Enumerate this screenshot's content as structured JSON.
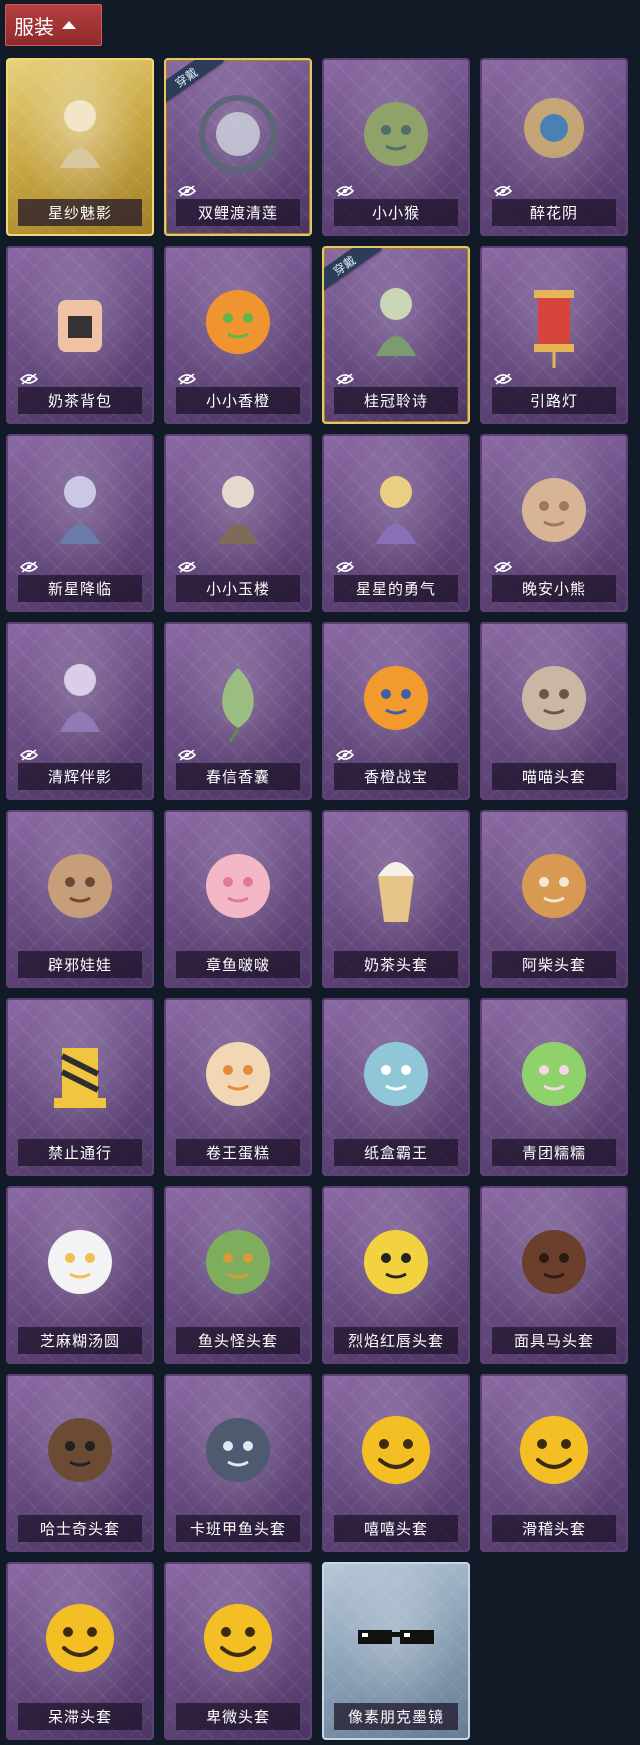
{
  "header": {
    "title": "服装"
  },
  "items": [
    {
      "name": "星纱魅影",
      "theme": "gold",
      "hidden_icon": false,
      "worn": false,
      "icon": "veil-figure"
    },
    {
      "name": "双鲤渡清莲",
      "theme": "purple",
      "hidden_icon": true,
      "worn": true,
      "worn_label": "穿戴",
      "icon": "koi-lotus"
    },
    {
      "name": "小小猴",
      "theme": "purple",
      "hidden_icon": true,
      "worn": false,
      "icon": "monkey"
    },
    {
      "name": "醉花阴",
      "theme": "purple",
      "hidden_icon": true,
      "worn": false,
      "icon": "flower-ornament"
    },
    {
      "name": "奶茶背包",
      "theme": "purple",
      "hidden_icon": true,
      "worn": false,
      "icon": "backpack"
    },
    {
      "name": "小小香橙",
      "theme": "purple",
      "hidden_icon": true,
      "worn": false,
      "icon": "orange"
    },
    {
      "name": "桂冠聆诗",
      "theme": "purple",
      "hidden_icon": true,
      "worn": true,
      "worn_label": "穿戴",
      "icon": "laurel-charm"
    },
    {
      "name": "引路灯",
      "theme": "purple",
      "hidden_icon": true,
      "worn": false,
      "icon": "lantern"
    },
    {
      "name": "新星降临",
      "theme": "purple",
      "hidden_icon": true,
      "worn": false,
      "icon": "star-charm"
    },
    {
      "name": "小小玉楼",
      "theme": "purple",
      "hidden_icon": true,
      "worn": false,
      "icon": "hat-doll"
    },
    {
      "name": "星星的勇气",
      "theme": "purple",
      "hidden_icon": true,
      "worn": false,
      "icon": "planet-charm"
    },
    {
      "name": "晚安小熊",
      "theme": "purple",
      "hidden_icon": true,
      "worn": false,
      "icon": "bear"
    },
    {
      "name": "清辉伴影",
      "theme": "purple",
      "hidden_icon": true,
      "worn": false,
      "icon": "moon-doll"
    },
    {
      "name": "春信香囊",
      "theme": "purple",
      "hidden_icon": true,
      "worn": false,
      "icon": "sachet"
    },
    {
      "name": "香橙战宝",
      "theme": "purple",
      "hidden_icon": true,
      "worn": false,
      "icon": "orange-warrior"
    },
    {
      "name": "喵喵头套",
      "theme": "purple",
      "hidden_icon": false,
      "worn": false,
      "icon": "cat-head"
    },
    {
      "name": "辟邪娃娃",
      "theme": "purple",
      "hidden_icon": false,
      "worn": false,
      "icon": "doll-head"
    },
    {
      "name": "章鱼啵啵",
      "theme": "purple",
      "hidden_icon": false,
      "worn": false,
      "icon": "octopus"
    },
    {
      "name": "奶茶头套",
      "theme": "purple",
      "hidden_icon": false,
      "worn": false,
      "icon": "milk-tea"
    },
    {
      "name": "阿柴头套",
      "theme": "purple",
      "hidden_icon": false,
      "worn": false,
      "icon": "shiba"
    },
    {
      "name": "禁止通行",
      "theme": "purple",
      "hidden_icon": false,
      "worn": false,
      "icon": "barrier"
    },
    {
      "name": "卷王蛋糕",
      "theme": "purple",
      "hidden_icon": false,
      "worn": false,
      "icon": "roll-cake"
    },
    {
      "name": "纸盒霸王",
      "theme": "purple",
      "hidden_icon": false,
      "worn": false,
      "icon": "box-dino"
    },
    {
      "name": "青团糯糯",
      "theme": "purple",
      "hidden_icon": false,
      "worn": false,
      "icon": "green-bun"
    },
    {
      "name": "芝麻糊汤圆",
      "theme": "purple",
      "hidden_icon": false,
      "worn": false,
      "icon": "dumpling"
    },
    {
      "name": "鱼头怪头套",
      "theme": "purple",
      "hidden_icon": false,
      "worn": false,
      "icon": "fish-head"
    },
    {
      "name": "烈焰红唇头套",
      "theme": "purple",
      "hidden_icon": false,
      "worn": false,
      "icon": "pikachu-head"
    },
    {
      "name": "面具马头套",
      "theme": "purple",
      "hidden_icon": false,
      "worn": false,
      "icon": "horse-head"
    },
    {
      "name": "哈士奇头套",
      "theme": "purple",
      "hidden_icon": false,
      "worn": false,
      "icon": "husky-head"
    },
    {
      "name": "卡班甲鱼头套",
      "theme": "purple",
      "hidden_icon": false,
      "worn": false,
      "icon": "fish-blob"
    },
    {
      "name": "嘻嘻头套",
      "theme": "purple",
      "hidden_icon": false,
      "worn": false,
      "icon": "grin-emoji"
    },
    {
      "name": "滑稽头套",
      "theme": "purple",
      "hidden_icon": false,
      "worn": false,
      "icon": "smirk-emoji"
    },
    {
      "name": "呆滞头套",
      "theme": "purple",
      "hidden_icon": false,
      "worn": false,
      "icon": "dazed-emoji"
    },
    {
      "name": "卑微头套",
      "theme": "purple",
      "hidden_icon": false,
      "worn": false,
      "icon": "humble-emoji"
    },
    {
      "name": "像素朋克墨镜",
      "theme": "silver",
      "hidden_icon": false,
      "worn": false,
      "icon": "pixel-sunglasses"
    }
  ]
}
